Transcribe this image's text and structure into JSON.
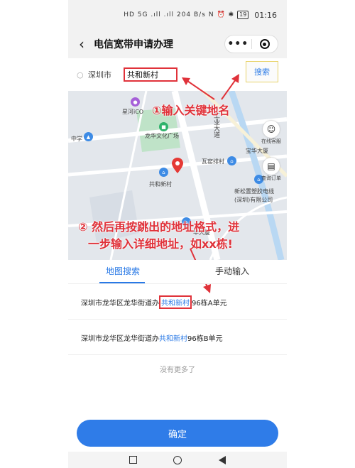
{
  "status_bar": {
    "network": "HD 5G .ıll .ıll",
    "speed": "204 B/s",
    "icons": "N ⏰ ✱",
    "battery": "19",
    "time": "01:16"
  },
  "header": {
    "title": "电信宽带申请办理"
  },
  "search": {
    "city": "深圳市",
    "value": "共和新村",
    "button_label": "搜索"
  },
  "map": {
    "labels": {
      "xingheico": "星河iCO",
      "zhongxue": "中学",
      "longhua_square": "龙华文化广场",
      "gonghe": "共和新村",
      "waku": "瓦窑排村",
      "baohua": "宝华大厦",
      "xinsong": "新松置塑胶电线",
      "shenzhen_co": "(深圳)有限公司",
      "road_gongye": "工业大道",
      "road_hua": "华大厦"
    },
    "side_buttons": {
      "service": "在线客服",
      "order": "查询订单"
    }
  },
  "annotations": {
    "step1": "①输入关键地名",
    "step2_line1": "② 然后再按跳出的地址格式，进",
    "step2_line2": "一步输入详细地址，如xx栋!"
  },
  "tabs": {
    "map_search": "地图搜索",
    "manual_input": "手动输入"
  },
  "results": [
    {
      "prefix": "深圳市龙华区龙华街道办",
      "highlight": "共和新村",
      "suffix": "96栋A单元"
    },
    {
      "prefix": "深圳市龙华区龙华街道办",
      "highlight": "共和新村",
      "suffix": "96栋B单元"
    }
  ],
  "no_more": "没有更多了",
  "confirm_label": "确定",
  "colors": {
    "accent": "#2979e6",
    "annotation": "#e0323a",
    "button": "#2f7ce8"
  }
}
